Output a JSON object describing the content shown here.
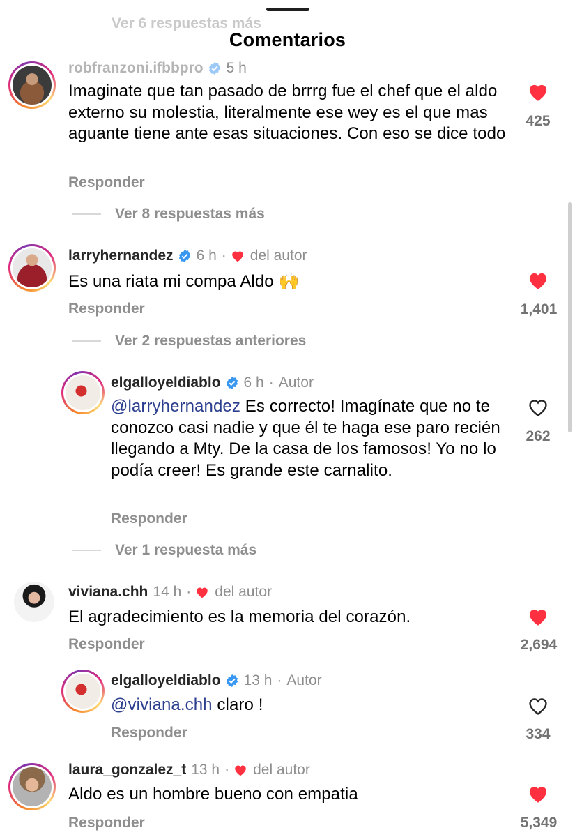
{
  "sheet": {
    "title": "Comentarios",
    "ghost_text": "Ver 6 respuestas más"
  },
  "colors": {
    "like_red": "#ff3040",
    "verified_blue": "#3897f0",
    "mention_blue": "#2c3f8f",
    "secondary_text": "#8e8e8e"
  },
  "comments": [
    {
      "username": "robfranzoni.ifbbpro",
      "time": "5 h",
      "text": "Imaginate que tan pasado de brrrg fue el chef que el aldo externo su molestia, literalmente ese wey es el que mas aguante tiene ante esas situaciones. Con eso se dice todo",
      "reply_label": "Responder",
      "likes": "425",
      "liked": true,
      "more_replies": "Ver 8 respuestas más"
    },
    {
      "username": "larryhernandez",
      "time": "6 h",
      "author_like": "del autor",
      "text": "Es una riata mi compa Aldo 🙌",
      "reply_label": "Responder",
      "likes": "1,401",
      "liked": true,
      "more_replies": "Ver 2 respuestas anteriores"
    },
    {
      "username": "elgalloyeldiablo",
      "time": "6 h",
      "author_tag": "Autor",
      "mention": "@larryhernandez",
      "text": " Es correcto! Imagínate que no te conozco casi nadie y que él te haga ese paro recién llegando a Mty. De la casa de los famosos! Yo no lo podía creer! Es grande este carnalito.",
      "reply_label": "Responder",
      "likes": "262",
      "liked": false,
      "more_replies": "Ver 1 respuesta más"
    },
    {
      "username": "viviana.chh",
      "time": "14 h",
      "author_like": "del autor",
      "text": "El agradecimiento es la memoria del corazón.",
      "reply_label": "Responder",
      "likes": "2,694",
      "liked": true
    },
    {
      "username": "elgalloyeldiablo",
      "time": "13 h",
      "author_tag": "Autor",
      "mention": "@viviana.chh",
      "text": " claro !",
      "reply_label": "Responder",
      "likes": "334",
      "liked": false
    },
    {
      "username": "laura_gonzalez_t",
      "time": "13 h",
      "author_like": "del autor",
      "text": "Aldo es un hombre bueno con empatia",
      "reply_label": "Responder",
      "likes": "5,349",
      "liked": true
    }
  ]
}
